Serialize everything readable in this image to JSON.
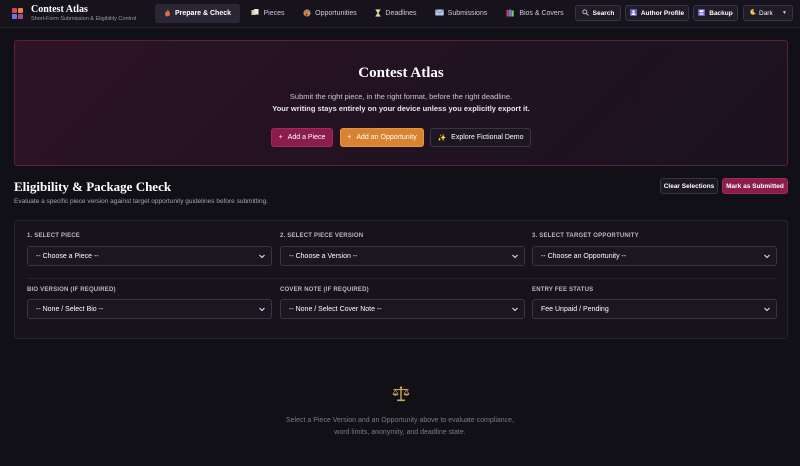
{
  "brand": {
    "title": "Contest Atlas",
    "subtitle": "Short-Form Submission & Eligibility Control"
  },
  "nav": {
    "items": [
      {
        "label": "Prepare & Check",
        "icon": "flame-icon",
        "active": true
      },
      {
        "label": "Pieces",
        "icon": "pages-icon"
      },
      {
        "label": "Opportunities",
        "icon": "palette-icon"
      },
      {
        "label": "Deadlines",
        "icon": "hourglass-icon"
      },
      {
        "label": "Submissions",
        "icon": "mail-icon"
      },
      {
        "label": "Bios & Covers",
        "icon": "books-icon"
      }
    ],
    "search_label": "Search",
    "author_label": "Author Profile",
    "backup_label": "Backup",
    "theme_value": "Dark"
  },
  "hero": {
    "title": "Contest Atlas",
    "line1": "Submit the right piece, in the right format, before the right deadline.",
    "line2": "Your writing stays entirely on your device unless you explicitly export it.",
    "add_piece_label": "Add a Piece",
    "add_opportunity_label": "Add an Opportunity",
    "demo_label": "Explore Fictional Demo"
  },
  "section": {
    "title": "Eligibility & Package Check",
    "subtitle": "Evaluate a specific piece version against target opportunity guidelines before submitting.",
    "clear_label": "Clear Selections",
    "mark_label": "Mark as Submitted"
  },
  "form": {
    "piece_label": "1. SELECT PIECE",
    "piece_value": "-- Choose a Piece --",
    "version_label": "2. SELECT PIECE VERSION",
    "version_value": "-- Choose a Version --",
    "opportunity_label": "3. SELECT TARGET OPPORTUNITY",
    "opportunity_value": "-- Choose an Opportunity --",
    "bio_label": "BIO VERSION (IF REQUIRED)",
    "bio_value": "-- None / Select Bio --",
    "cover_label": "COVER NOTE (IF REQUIRED)",
    "cover_value": "-- None / Select Cover Note --",
    "fee_label": "ENTRY FEE STATUS",
    "fee_value": "Fee Unpaid / Pending"
  },
  "empty_state": {
    "icon": "scales-icon",
    "text": "Select a Piece Version and an Opportunity above to evaluate compliance, word limits, anonymity, and deadline state."
  },
  "colors": {
    "accent": "#8a1d4b",
    "secondary": "#d9822f",
    "background": "#121017"
  }
}
